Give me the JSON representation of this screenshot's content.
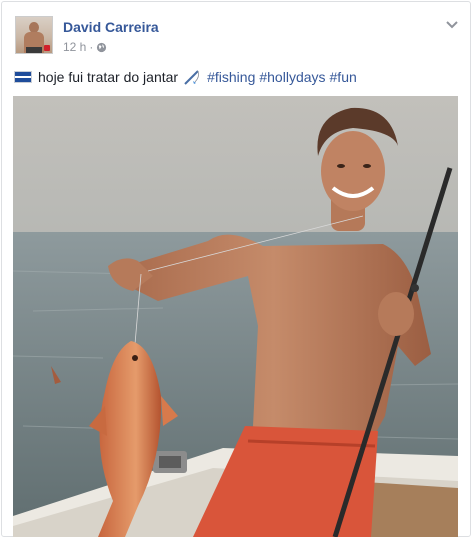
{
  "post": {
    "author_name": "David Carreira",
    "timestamp": "12 h",
    "separator": "·",
    "text": "hoje fui tratar do jantar",
    "hashtags": [
      "#fishing",
      "#hollydays",
      "#fun"
    ]
  },
  "icons": {
    "avatar": "profile-photo",
    "privacy": "globe-icon",
    "options": "chevron-down-icon",
    "flag": "flag-icon",
    "emoji": "fishing-pole-emoji"
  },
  "colors": {
    "link": "#365899",
    "meta": "#90949c",
    "text": "#1d2129",
    "border": "#dddfe2"
  }
}
